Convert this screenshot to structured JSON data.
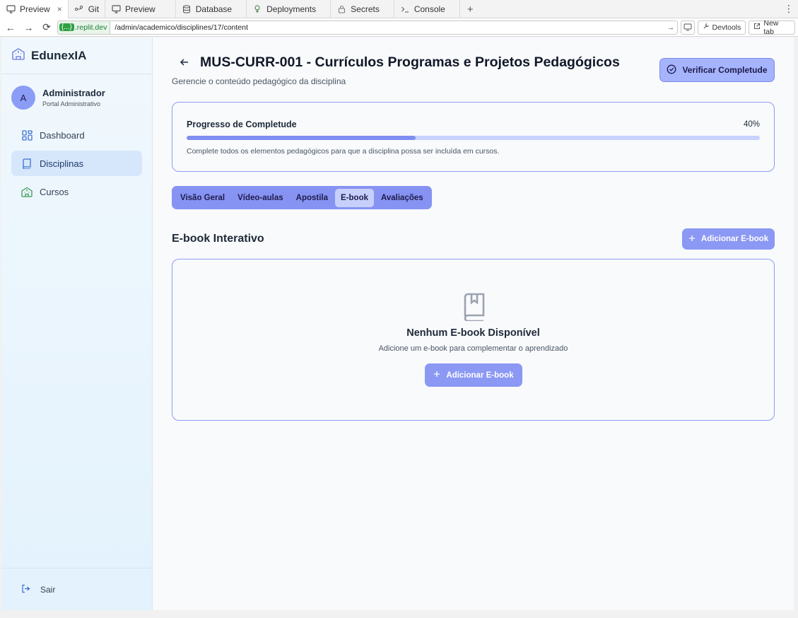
{
  "ide_tabs": [
    {
      "label": "Preview",
      "icon": "monitor-icon",
      "closable": true
    },
    {
      "label": "Git",
      "icon": "git-icon"
    },
    {
      "label": "Preview",
      "icon": "monitor-icon"
    },
    {
      "label": "Database",
      "icon": "database-icon"
    },
    {
      "label": "Deployments",
      "icon": "deploy-icon"
    },
    {
      "label": "Secrets",
      "icon": "lock-icon"
    },
    {
      "label": "Console",
      "icon": "terminal-icon"
    }
  ],
  "address_bar": {
    "host_badge": "{...}",
    "host": ".replit.dev",
    "path": "/admin/academico/disciplines/17/content",
    "devtools_label": "Devtools",
    "newtab_label": "New tab"
  },
  "sidebar": {
    "brand": "EdunexIA",
    "user": {
      "initial": "A",
      "name": "Administrador",
      "role": "Portal Administrativo"
    },
    "items": [
      {
        "label": "Dashboard",
        "icon": "dashboard-icon",
        "active": false
      },
      {
        "label": "Disciplinas",
        "icon": "book-icon",
        "active": true
      },
      {
        "label": "Cursos",
        "icon": "school-icon",
        "active": false
      }
    ],
    "logout_label": "Sair"
  },
  "header": {
    "title": "MUS-CURR-001 - Currículos Programas e Projetos Pedagógicos",
    "subtitle": "Gerencie o conteúdo pedagógico da disciplina",
    "verify_label": "Verificar Completude"
  },
  "progress": {
    "label": "Progresso de Completude",
    "percent_text": "40%",
    "value": 0.4,
    "note": "Complete todos os elementos pedagógicos para que a disciplina possa ser incluída em cursos."
  },
  "tabs": [
    {
      "label": "Visão Geral",
      "active": false
    },
    {
      "label": "Vídeo-aulas",
      "active": false
    },
    {
      "label": "Apostila",
      "active": false
    },
    {
      "label": "E-book",
      "active": true
    },
    {
      "label": "Avaliações",
      "active": false
    }
  ],
  "section": {
    "title": "E-book Interativo",
    "add_label": "Adicionar E-book"
  },
  "empty_state": {
    "title": "Nenhum E-book Disponível",
    "description": "Adicione um e-book para complementar o aprendizado",
    "add_label": "Adicionar E-book"
  },
  "colors": {
    "accent": "#8b98f4",
    "progress_fill": "#7f8ef0",
    "progress_track": "#c7d2fe",
    "sidebar_active": "#d7e7fb"
  }
}
